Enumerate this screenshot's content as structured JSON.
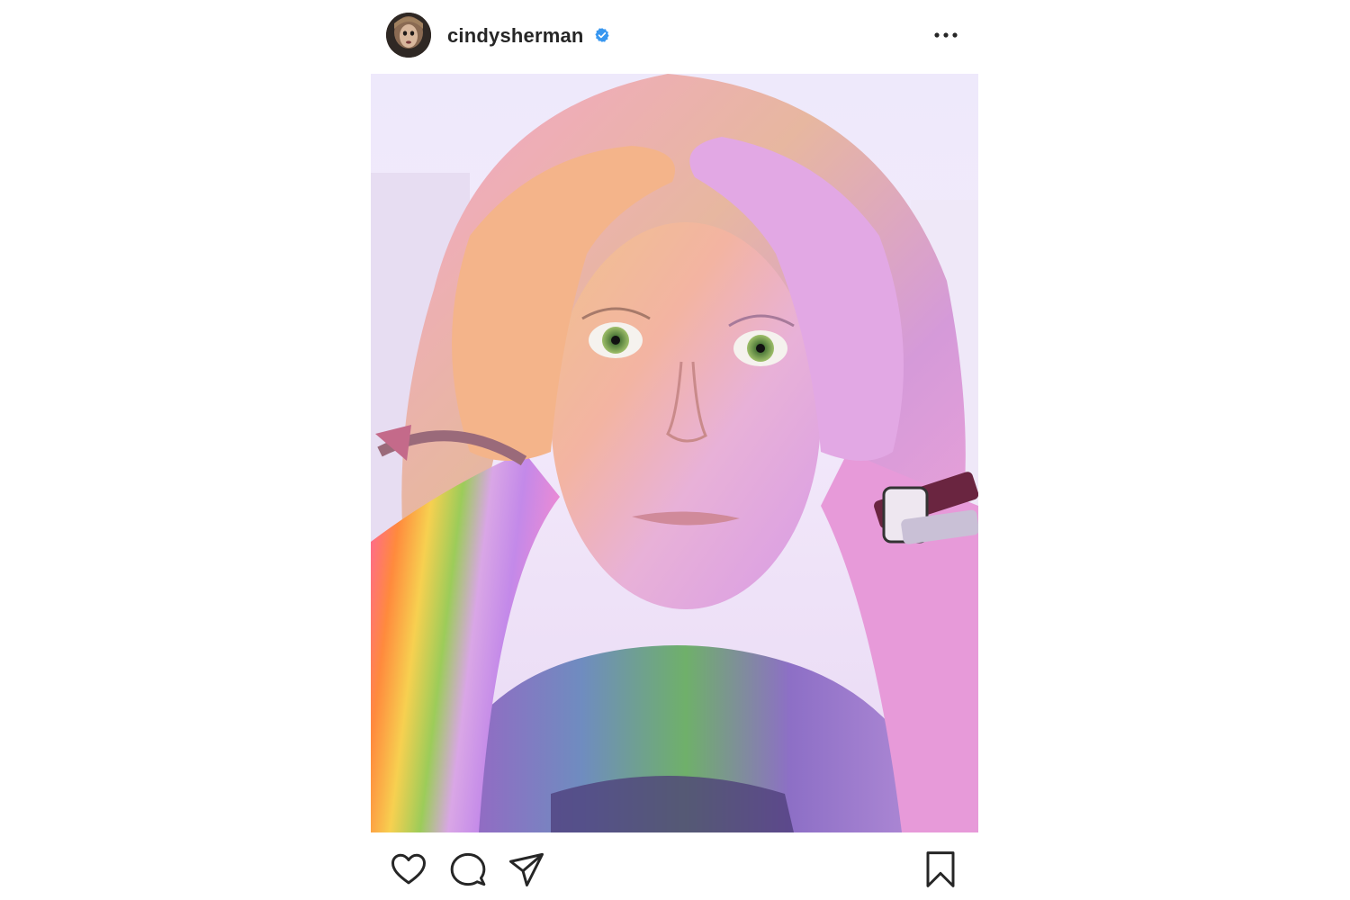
{
  "post": {
    "username": "cindysherman",
    "verified": true,
    "icons": {
      "avatar": "profile-avatar",
      "verified": "verified-badge-icon",
      "more": "more-options-icon",
      "like": "heart-icon",
      "comment": "comment-bubble-icon",
      "share": "paper-plane-icon",
      "save": "bookmark-icon"
    },
    "colors": {
      "text": "#262626",
      "verified_blue": "#3897f0",
      "icon_stroke": "#262626"
    }
  }
}
